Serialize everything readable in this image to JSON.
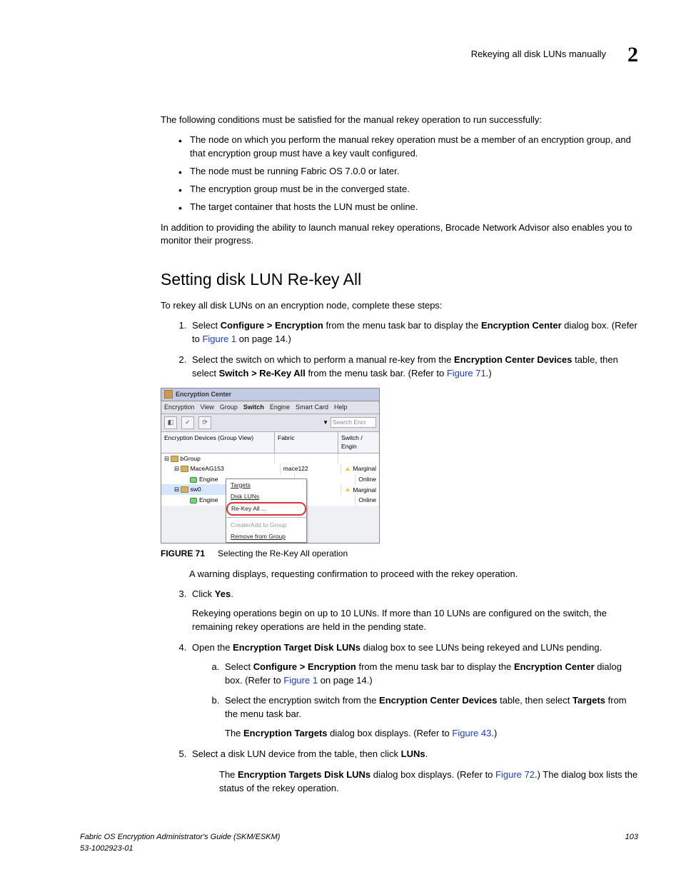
{
  "header": {
    "running": "Rekeying all disk LUNs manually",
    "chapter": "2"
  },
  "intro": "The following conditions must be satisfied for the manual rekey operation to run successfully:",
  "bullets": [
    "The node on which you perform the manual rekey operation must be a member of an encryption group, and that encryption group must have a key vault configured.",
    "The node must be running Fabric OS 7.0.0 or later.",
    "The encryption group must be in the converged state.",
    "The target container that hosts the LUN must be online."
  ],
  "intro2": "In addition to providing the ability to launch manual rekey operations, Brocade Network Advisor also enables you to monitor their progress.",
  "section_title": "Setting disk LUN Re-key All",
  "section_lead": "To rekey all disk LUNs on an encryption node, complete these steps:",
  "step1": {
    "pre": "Select ",
    "menu": "Configure > Encryption",
    "mid": " from the menu task bar to display the ",
    "dlg": "Encryption Center",
    "post": " dialog box. (Refer to ",
    "link": "Figure 1",
    "tail": " on page 14.)"
  },
  "step2": {
    "pre": "Select the switch on which to perform a manual re-key from the ",
    "tbl": "Encryption Center Devices",
    "mid1": " table, then select ",
    "menu": "Switch > Re-Key All",
    "mid2": " from the menu task bar. (Refer to ",
    "link": "Figure 71",
    "tail": ".)"
  },
  "shot": {
    "title": "Encryption Center",
    "menus": [
      "Encryption",
      "View",
      "Group",
      "Switch",
      "Engine",
      "Smart Card",
      "Help"
    ],
    "search": "Search Encr",
    "cols": {
      "c1": "Encryption Devices (Group View)",
      "c2": "Fabric",
      "c3": "Switch / Engin"
    },
    "r1": {
      "c1": "⊟  bGroup",
      "c2": "",
      "c3": ""
    },
    "r2": {
      "c1": "⊟  MaceAG153",
      "c2": "mace122",
      "c3": "Marginal"
    },
    "r3": {
      "c1": "Engine",
      "c2": "",
      "c3": "Online"
    },
    "r4": {
      "c1": "⊟  sw0",
      "c2": "",
      "c3": "Marginal"
    },
    "r5": {
      "c1": "Engine",
      "c2": "",
      "c3": "Online"
    },
    "popup": {
      "i1": "Targets",
      "i2": "Disk LUNs",
      "i3": "Re-Key All ...",
      "i4": "Create/Add to Group",
      "i5": "Remove from Group"
    }
  },
  "figure": {
    "label": "FIGURE 71",
    "caption": "Selecting the Re-Key All operation"
  },
  "warn": "A warning displays, requesting confirmation to proceed with the rekey operation.",
  "step3": {
    "pre": "Click ",
    "b": "Yes",
    "post": "."
  },
  "step3b": "Rekeying operations begin on up to 10 LUNs. If more than 10 LUNs are configured on the switch, the remaining rekey operations are held in the pending state.",
  "step4": {
    "pre": "Open the ",
    "b": "Encryption Target Disk LUNs",
    "post": " dialog box to see LUNs being rekeyed and LUNs pending."
  },
  "step4a": {
    "pre": "Select ",
    "menu": "Configure > Encryption",
    "mid": " from the menu task bar to display the ",
    "dlg": "Encryption Center",
    "post": " dialog box. (Refer to ",
    "link": "Figure 1",
    "tail": " on page 14.)"
  },
  "step4b": {
    "pre": "Select the encryption switch from the ",
    "tbl": "Encryption Center Devices",
    "mid": " table, then select ",
    "menu": "Targets",
    "post": " from the menu task bar."
  },
  "step4b_after": {
    "pre": "The ",
    "b": "Encryption Targets",
    "mid": " dialog box displays. (Refer to ",
    "link": "Figure 43",
    "tail": ".)"
  },
  "step5": {
    "pre": "Select a disk LUN device from the table, then click ",
    "b": "LUNs",
    "post": "."
  },
  "step5_after": {
    "pre": "The ",
    "b": "Encryption Targets Disk LUNs",
    "mid": " dialog box displays. (Refer to ",
    "link": "Figure 72",
    "tail": ".) The dialog box lists the status of the rekey operation."
  },
  "footer": {
    "l1": "Fabric OS Encryption Administrator's Guide (SKM/ESKM)",
    "l2": "53-1002923-01",
    "page": "103"
  }
}
